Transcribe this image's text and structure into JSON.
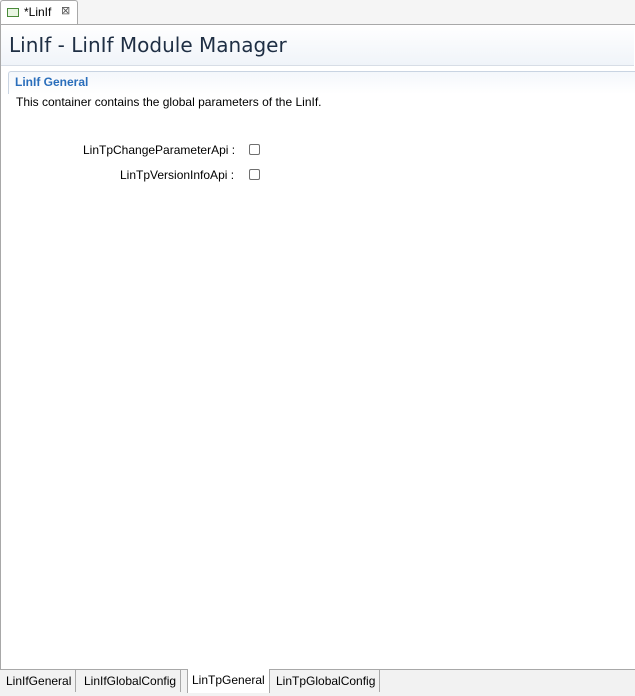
{
  "editor": {
    "tab_title": "*LinIf",
    "tab_close": "⊠"
  },
  "header": {
    "title": "LinIf - LinIf Module Manager"
  },
  "section": {
    "title": "LinIf General",
    "description": "This container contains the global parameters of the LinIf."
  },
  "fields": {
    "change_parameter_api": {
      "label": "LinTpChangeParameterApi :",
      "checked": false
    },
    "version_info_api": {
      "label": "LinTpVersionInfoApi :",
      "checked": false
    }
  },
  "page_tabs": {
    "tab1": "LinIfGeneral",
    "tab2": "LinIfGlobalConfig",
    "tab3": "LinTpGeneral",
    "tab4": "LinTpGlobalConfig",
    "active": "LinTpGeneral"
  },
  "colors": {
    "section_title": "#2a6ebb",
    "header_title": "#1f2f44"
  },
  "icons": {
    "editor_tab": "module-editor-icon",
    "close": "close-icon"
  }
}
